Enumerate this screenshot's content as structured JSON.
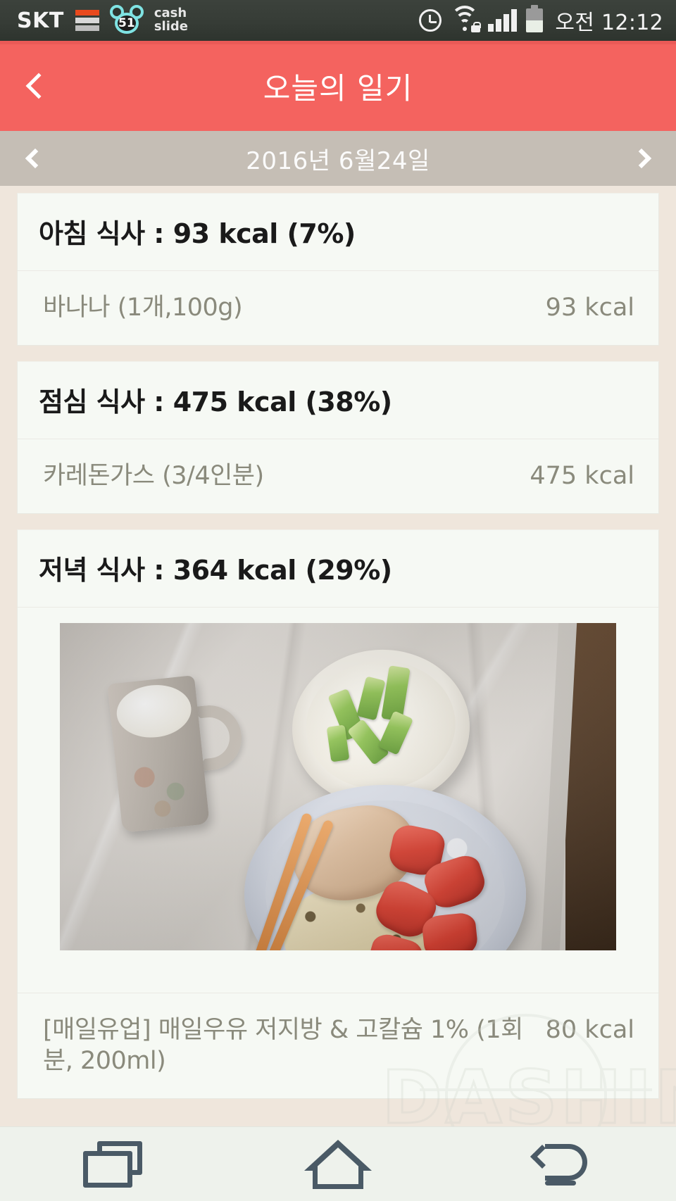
{
  "status_bar": {
    "carrier": "SKT",
    "signal_icon": "signal-bars-icon",
    "cashslide": {
      "badge": "51",
      "line1": "cash",
      "line2": "slide",
      "icon": "mouse-head-icon"
    },
    "alarm_icon": "alarm-clock-icon",
    "wifi_icon": "wifi-locked-icon",
    "battery_icon": "battery-icon",
    "clock": "오전 12:12"
  },
  "app_bar": {
    "title": "오늘의 일기",
    "back_icon": "chevron-left-icon"
  },
  "date_bar": {
    "date": "2016년 6월24일",
    "prev_icon": "chevron-left-icon",
    "next_icon": "chevron-right-icon"
  },
  "meals": [
    {
      "header": "아침 식사 : 93 kcal (7%)",
      "meal_name": "아침 식사",
      "calories": "93 kcal",
      "percent": "7%",
      "items": [
        {
          "name": "바나나 (1개,100g)",
          "kcal": "93 kcal"
        }
      ],
      "has_photo": false
    },
    {
      "header": "점심 식사 : 475 kcal (38%)",
      "meal_name": "점심 식사",
      "calories": "475 kcal",
      "percent": "38%",
      "items": [
        {
          "name": "카레돈가스 (3/4인분)",
          "kcal": "475 kcal"
        }
      ],
      "has_photo": false
    },
    {
      "header": "저녁 식사 : 364 kcal (29%)",
      "meal_name": "저녁 식사",
      "calories": "364 kcal",
      "percent": "29%",
      "items": [
        {
          "name": "[매일유업] 매일우유 저지방 & 고칼슘 1% (1회분, 200ml)",
          "kcal": "80 kcal"
        }
      ],
      "has_photo": true,
      "photo_alt": "대리석 식탁 위의 저녁 식사 사진 - 우유 머그컵, 오이 스틱 그릇, 닭가슴살과 토마토를 곁들인 볶음밥 접시, 나무 젓가락"
    }
  ],
  "watermark": {
    "text": "DASHIN"
  },
  "nav_bar": {
    "recents_icon": "recents-icon",
    "home_icon": "home-icon",
    "back_icon": "back-arrow-icon"
  },
  "colors": {
    "accent": "#F4635F",
    "date_bar": "#C5BEB5",
    "page_bg": "#EFE6DC",
    "card_bg": "#F6F9F4",
    "muted_text": "#8A8A7C",
    "nav_bg": "#EEF2EC",
    "nav_icon": "#4A5A66"
  }
}
